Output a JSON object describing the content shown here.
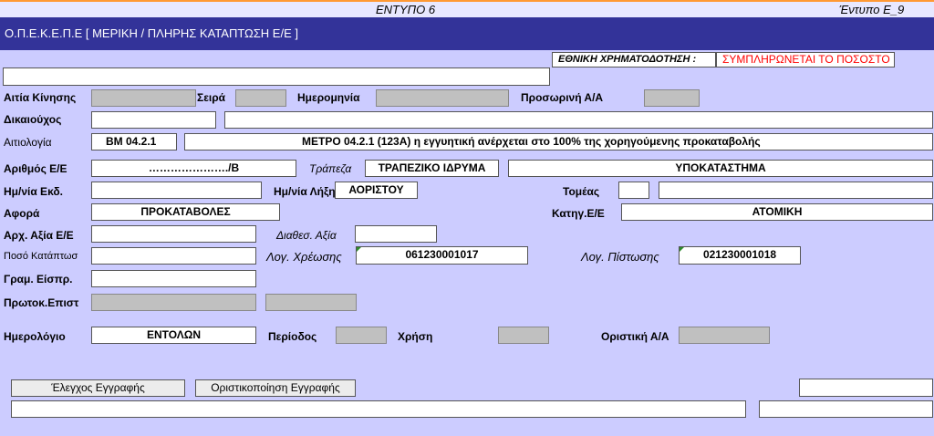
{
  "top": {
    "center_title": "ΕΝΤΥΠΟ 6",
    "right_title": "Έντυπο Ε_9"
  },
  "header": {
    "title": "Ο.Π.Ε.Κ.Ε.Π.Ε [ ΜΕΡΙΚΗ / ΠΛΗΡΗΣ ΚΑΤΑΠΤΩΣΗ Ε/Ε ]"
  },
  "funding": {
    "label": "ΕΘΝΙΚΗ ΧΡΗΜΑΤΟΔΟΤΗΣΗ :",
    "value": "ΣΥΜΠΛΗΡΩΝΕΤΑΙ ΤΟ ΠΟΣΟΣΤΟ"
  },
  "labels": {
    "aitia": "Αιτία Κίνησης",
    "seira": "Σειρά",
    "hmerominia": "Ημερομηνία",
    "prosorini": "Προσωρινή Α/Α",
    "dikaiouxos": "Δικαιούχος",
    "aitiologia": "Αιτιολογία",
    "arithmos": "Αριθμός Ε/Ε",
    "trapeza": "Τράπεζα",
    "ekdosi": "Ημ/νία Εκδ.",
    "lixi": "Ημ/νία Λήξης",
    "tomeas": "Τομέας",
    "afora": "Αφορά",
    "katig": "Κατηγ.Ε/Ε",
    "arx_axia": "Αρχ. Αξία Ε/Ε",
    "diathes": "Διαθεσ. Αξία",
    "poso": "Ποσό Κατάπτωσ",
    "log_xreosis": "Λογ. Χρέωσης",
    "log_pistosis": "Λογ. Πίστωσης",
    "gram": "Γραμ. Είσπρ.",
    "protok": "Πρωτοκ.Επιστ",
    "hmerologio": "Ημερολόγιο",
    "periodos": "Περίοδος",
    "xrisi": "Χρήση",
    "oristiki": "Οριστική Α/Α"
  },
  "values": {
    "aitiologia_code": "ΒΜ 04.2.1",
    "aitiologia_text": "ΜΕΤΡΟ 04.2.1 (123Α) η εγγυητική ανέρχεται στο 100% της χορηγούμενης προκαταβολής",
    "arithmos": "…………………./Β",
    "trapeza": "ΤΡΑΠΕΖΙΚΟ ΙΔΡΥΜΑ",
    "ypokatastima": "ΥΠΟΚΑΤΑΣΤΗΜΑ",
    "lixi": "ΑΟΡΙΣΤΟΥ",
    "afora": "ΠΡΟΚΑΤΑΒΟΛΕΣ",
    "katig": "ΑΤΟΜΙΚΗ",
    "log_xreosis": "061230001017",
    "log_pistosis": "021230001018",
    "hmerologio": "ΕΝΤΟΛΩΝ"
  },
  "buttons": {
    "check": "Έλεγχος Εγγραφής",
    "finalize": "Οριστικοποίηση Εγγραφής"
  },
  "colors": {
    "background": "#ccccff",
    "header": "#333399",
    "accent": "#ff9933",
    "warning": "#ff0000"
  }
}
